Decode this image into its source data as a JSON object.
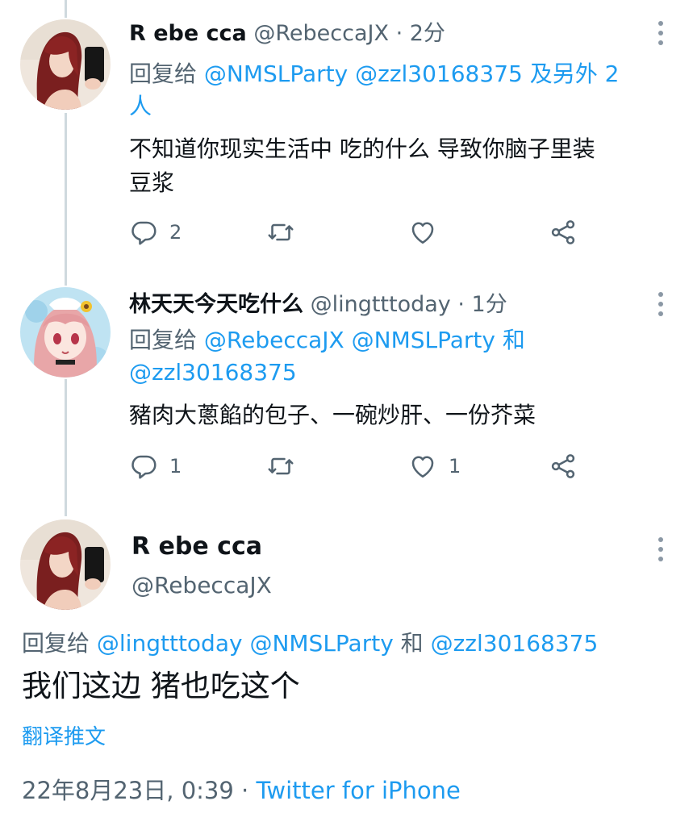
{
  "tweets": [
    {
      "name": "R ebe cca",
      "handle": "@RebeccaJX",
      "sep": " · ",
      "time": "2分",
      "reply_prefix": "回复给 ",
      "reply_line1": "@NMSLParty @zzl30168375 及另外 2",
      "reply_line2": "人",
      "text_line1": "不知道你现实生活中 吃的什么 导致你脑子里装",
      "text_line2": "豆浆",
      "replies": "2",
      "retweets": "",
      "likes": "",
      "avatar_icon": "selfie-avatar"
    },
    {
      "name": "林天天今天吃什么",
      "handle": "@lingtttoday",
      "sep": " · ",
      "time": "1分",
      "reply_prefix": "回复给 ",
      "reply_line1": "@RebeccaJX @NMSLParty 和",
      "reply_line2": "@zzl30168375",
      "text_line1": "豬肉大蔥餡的包子、一碗炒肝、一份芥菜",
      "replies": "1",
      "retweets": "",
      "likes": "1",
      "avatar_icon": "anime-girl-avatar"
    }
  ],
  "main_tweet": {
    "name": "R ebe cca",
    "handle": "@RebeccaJX",
    "reply_prefix": "回复给 ",
    "reply_mentions_a": "@lingtttoday @NMSLParty",
    "reply_and": " 和 ",
    "reply_mentions_b": "@zzl30168375",
    "text": "我们这边 猪也吃这个",
    "translate": "翻译推文",
    "date": "22年8月23日, 0:39",
    "sep": " · ",
    "source": "Twitter for iPhone"
  },
  "colors": {
    "link": "#1d9bf0",
    "secondary": "#536471",
    "primary_text": "#0f1419",
    "thread_line": "#cfd9de"
  },
  "icons": [
    "reply-icon",
    "retweet-icon",
    "like-icon",
    "share-icon",
    "more-icon"
  ]
}
